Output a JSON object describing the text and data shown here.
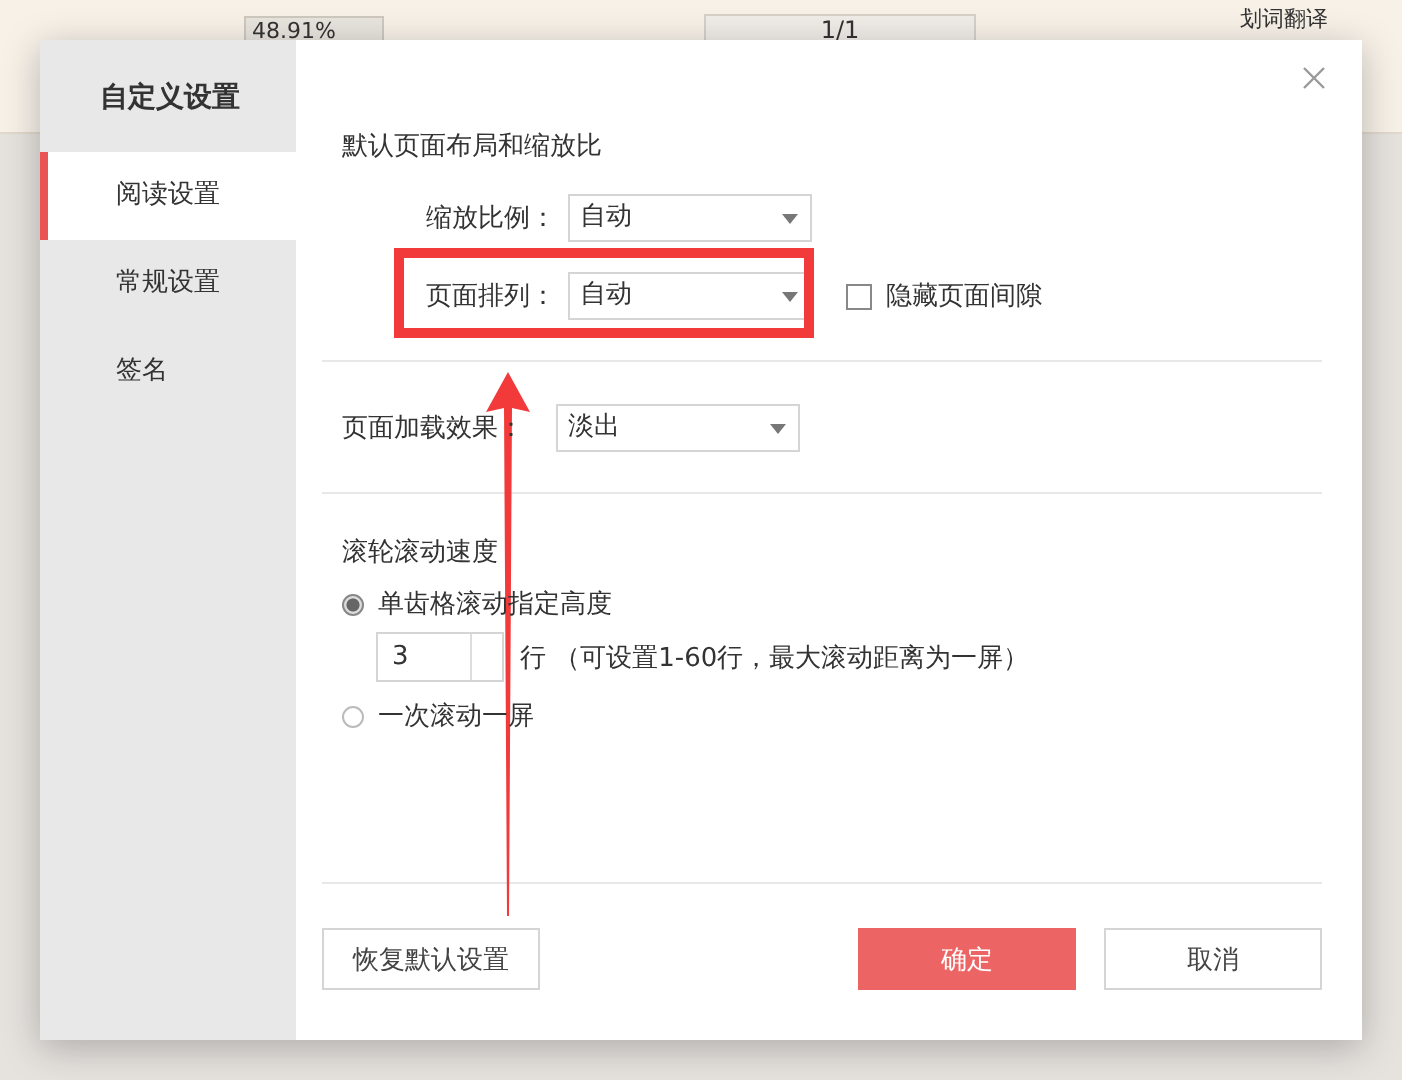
{
  "toolbar": {
    "zoom": "48.91%",
    "page": "1/1",
    "translate": "划词翻译"
  },
  "dialog": {
    "title": "自定义设置",
    "nav": [
      {
        "label": "阅读设置",
        "selected": true
      },
      {
        "label": "常规设置",
        "selected": false
      },
      {
        "label": "签名",
        "selected": false
      }
    ],
    "layout_section": "默认页面布局和缩放比",
    "zoom_row": {
      "label": "缩放比例：",
      "value": "自动"
    },
    "arrange_row": {
      "label": "页面排列：",
      "value": "自动"
    },
    "hide_gap": {
      "label": "隐藏页面间隙",
      "checked": false
    },
    "load_row": {
      "label": "页面加载效果：",
      "value": "淡出"
    },
    "scroll_section": "滚轮滚动速度",
    "scroll_options": [
      {
        "label": "单齿格滚动指定高度",
        "selected": true
      },
      {
        "label": "一次滚动一屏",
        "selected": false
      }
    ],
    "lines": {
      "value": "3",
      "hint": "行 （可设置1-60行，最大滚动距离为一屏）"
    },
    "buttons": {
      "reset": "恢复默认设置",
      "ok": "确定",
      "cancel": "取消"
    }
  }
}
